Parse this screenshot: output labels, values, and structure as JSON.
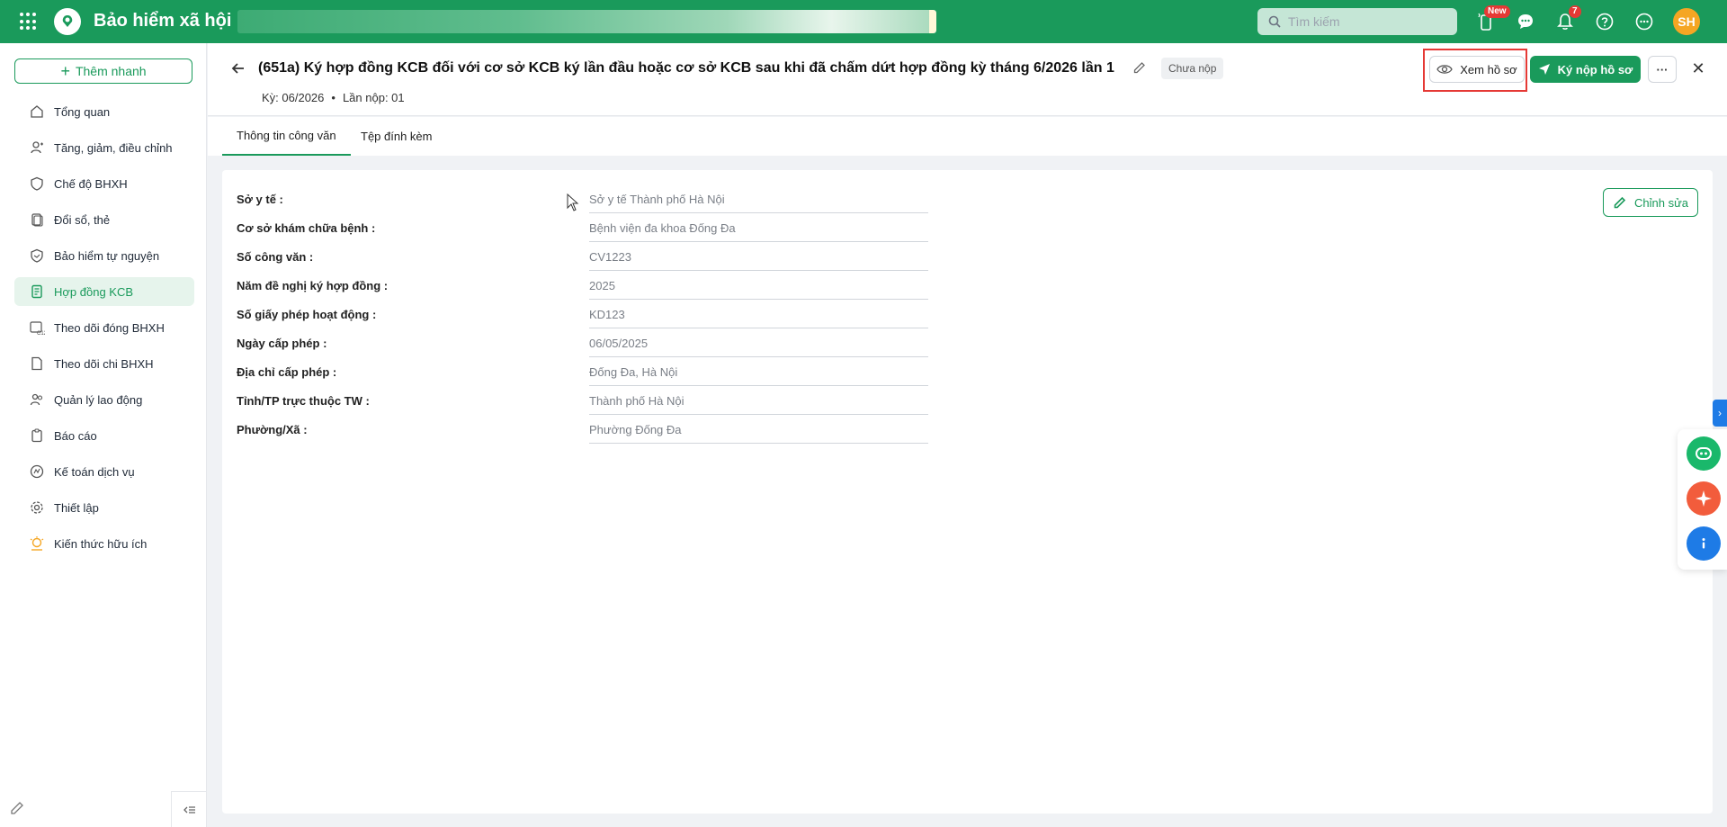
{
  "app": {
    "brand": "Bảo hiểm xã hội",
    "search_placeholder": "Tìm kiếm",
    "new_badge": "New",
    "notification_count": "7",
    "avatar_initials": "SH",
    "colors": {
      "primary": "#1a9a5b",
      "danger": "#e53935",
      "avatar": "#f5a623"
    }
  },
  "sidebar": {
    "quick_add": "Thêm nhanh",
    "items": [
      {
        "label": "Tổng quan",
        "icon": "home-icon"
      },
      {
        "label": "Tăng, giảm, điều chỉnh",
        "icon": "user-adjust-icon"
      },
      {
        "label": "Chế độ BHXH",
        "icon": "shield-heart-icon"
      },
      {
        "label": "Đổi sổ, thẻ",
        "icon": "card-swap-icon"
      },
      {
        "label": "Bảo hiểm tự nguyện",
        "icon": "shield-hand-icon"
      },
      {
        "label": "Hợp đồng KCB",
        "icon": "contract-icon"
      },
      {
        "label": "Theo dõi đóng BHXH",
        "icon": "c12-calendar-icon"
      },
      {
        "label": "Theo dõi chi BHXH",
        "icon": "document-icon"
      },
      {
        "label": "Quản lý lao động",
        "icon": "users-icon"
      },
      {
        "label": "Báo cáo",
        "icon": "report-icon"
      },
      {
        "label": "Kế toán dịch vụ",
        "icon": "accounting-icon"
      },
      {
        "label": "Thiết lập",
        "icon": "gear-icon"
      },
      {
        "label": "Kiến thức hữu ích",
        "icon": "bulb-icon"
      }
    ]
  },
  "header": {
    "title": "(651a) Ký hợp đồng KCB đối với cơ sở KCB ký lần đầu hoặc cơ sở KCB sau khi đã chấm dứt hợp đồng kỳ tháng 6/2026 lần 1",
    "status": "Chưa nộp",
    "period": "Kỳ: 06/2026",
    "submission": "Lần nộp: 01",
    "view_button": "Xem hồ sơ",
    "sign_button": "Ký nộp hồ sơ"
  },
  "tabs": [
    "Thông tin công văn",
    "Tệp đính kèm"
  ],
  "form": {
    "edit_button": "Chỉnh sửa",
    "fields": [
      {
        "label": "Sở y tế :",
        "value": "Sở y tế Thành phố Hà Nội"
      },
      {
        "label": "Cơ sở khám chữa bệnh :",
        "value": "Bệnh viện đa khoa Đống Đa"
      },
      {
        "label": "Số công văn :",
        "value": "CV1223"
      },
      {
        "label": "Năm đề nghị ký hợp đồng :",
        "value": "2025"
      },
      {
        "label": "Số giấy phép hoạt động :",
        "value": "KD123"
      },
      {
        "label": "Ngày cấp phép :",
        "value": "06/05/2025"
      },
      {
        "label": "Địa chỉ cấp phép :",
        "value": "Đống Đa, Hà Nội"
      },
      {
        "label": "Tỉnh/TP trực thuộc TW :",
        "value": "Thành phố Hà Nội"
      },
      {
        "label": "Phường/Xã :",
        "value": "Phường Đống Đa"
      }
    ]
  }
}
